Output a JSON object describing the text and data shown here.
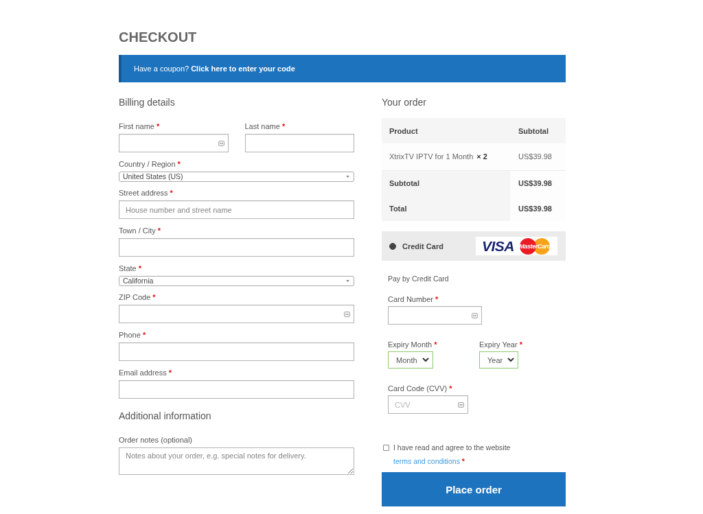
{
  "page_title": "CHECKOUT",
  "coupon_notice": {
    "text": "Have a coupon?",
    "link": "Click here to enter your code"
  },
  "billing": {
    "heading": "Billing details",
    "rows": [
      {
        "fields": [
          {
            "kind": "text",
            "label": "First name",
            "required_mark": "*",
            "autofill_icon": true
          },
          {
            "kind": "text",
            "label": "Last name",
            "required_mark": "*",
            "autofill_icon": false
          }
        ]
      },
      {
        "fields": [
          {
            "kind": "combobox",
            "label": "Country / Region",
            "required_mark": "*",
            "value": "United States (US)"
          }
        ]
      },
      {
        "fields": [
          {
            "kind": "text",
            "label": "Street address",
            "required_mark": "*",
            "placeholder": "House number and street name",
            "autofill_icon": false
          }
        ]
      },
      {
        "fields": [
          {
            "kind": "text",
            "label": "Town / City",
            "required_mark": "*",
            "autofill_icon": false
          }
        ]
      },
      {
        "fields": [
          {
            "kind": "combobox",
            "label": "State",
            "required_mark": "*",
            "value": "California"
          }
        ]
      },
      {
        "fields": [
          {
            "kind": "text",
            "label": "ZIP Code",
            "required_mark": "*",
            "autofill_icon": true
          }
        ]
      },
      {
        "fields": [
          {
            "kind": "text",
            "label": "Phone",
            "required_mark": "*",
            "autofill_icon": false
          }
        ]
      },
      {
        "fields": [
          {
            "kind": "text",
            "label": "Email address",
            "required_mark": "*",
            "autofill_icon": false
          }
        ]
      }
    ]
  },
  "additional": {
    "heading": "Additional information",
    "rows": [
      {
        "fields": [
          {
            "kind": "textarea",
            "label": "Order notes (optional)",
            "placeholder": "Notes about your order, e.g. special notes for delivery."
          }
        ]
      }
    ]
  },
  "order": {
    "heading": "Your order",
    "columns": [
      "Product",
      "Subtotal"
    ],
    "items": [
      {
        "name": "XtrixTV IPTV for 1 Month",
        "quantity": "× 2",
        "subtotal": "US$39.98"
      }
    ],
    "totals": [
      {
        "label": "Subtotal",
        "amount": "US$39.98"
      },
      {
        "label": "Total",
        "amount": "US$39.98"
      }
    ]
  },
  "payment_methods": [
    {
      "label": "Credit Card",
      "selected": true,
      "card_logos": [
        {
          "kind": "visa",
          "text": "VISA"
        },
        {
          "kind": "mastercard",
          "text": "MasterCard"
        }
      ],
      "description": "Pay by Credit Card",
      "rows": [
        {
          "fields": [
            {
              "kind": "text",
              "label": "Card Number",
              "required_mark": "*",
              "autofill_icon": true,
              "validated": false
            }
          ]
        },
        {
          "fields": [
            {
              "kind": "select",
              "label": "Expiry Month",
              "required_mark": "*",
              "value": "Month",
              "validated": true
            },
            {
              "kind": "select",
              "label": "Expiry Year",
              "required_mark": "*",
              "value": "Year",
              "validated": true
            }
          ]
        },
        {
          "fields": [
            {
              "kind": "text",
              "label": "Card Code (CVV)",
              "required_mark": "*",
              "placeholder": "CVV",
              "autofill_icon": true,
              "validated": false
            }
          ]
        }
      ]
    }
  ],
  "terms": {
    "checked": false,
    "text": "I have read and agree to the website",
    "link": "terms and conditions",
    "required_mark": "*"
  },
  "place_order": "Place order"
}
